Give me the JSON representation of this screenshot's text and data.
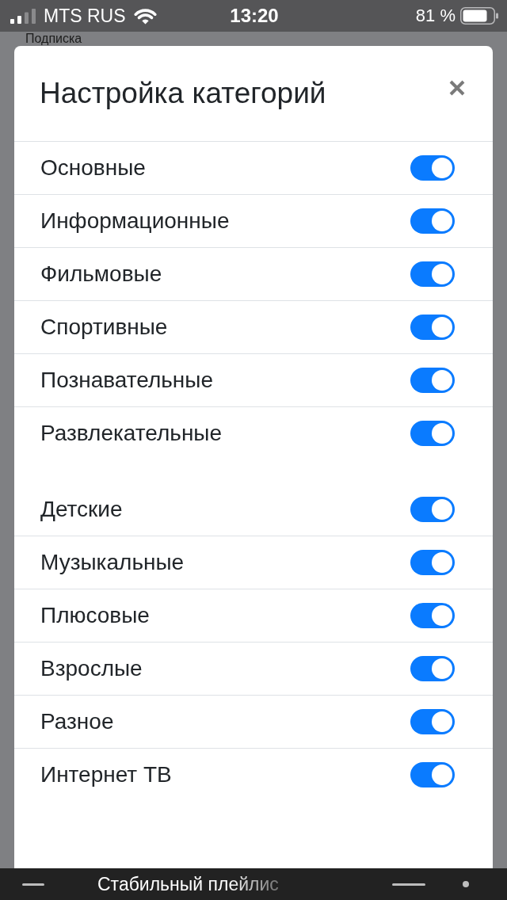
{
  "status_bar": {
    "carrier": "MTS RUS",
    "time": "13:20",
    "battery": "81 %"
  },
  "page": {
    "title": "Подписка"
  },
  "dialog": {
    "title": "Настройка категорий",
    "sections": [
      {
        "items": [
          {
            "label": "Основные",
            "on": true
          },
          {
            "label": "Информационные",
            "on": true
          },
          {
            "label": "Фильмовые",
            "on": true
          },
          {
            "label": "Спортивные",
            "on": true
          },
          {
            "label": "Познавательные",
            "on": true
          },
          {
            "label": "Развлекательные",
            "on": true
          }
        ]
      },
      {
        "items": [
          {
            "label": "Детские",
            "on": true
          },
          {
            "label": "Музыкальные",
            "on": true
          },
          {
            "label": "Плюсовые",
            "on": true
          },
          {
            "label": "Взрослые",
            "on": true
          },
          {
            "label": "Разное",
            "on": true
          },
          {
            "label": "Интернет ТВ",
            "on": true
          }
        ]
      }
    ]
  },
  "player_bar": {
    "title": "Стабильный плейлис"
  }
}
